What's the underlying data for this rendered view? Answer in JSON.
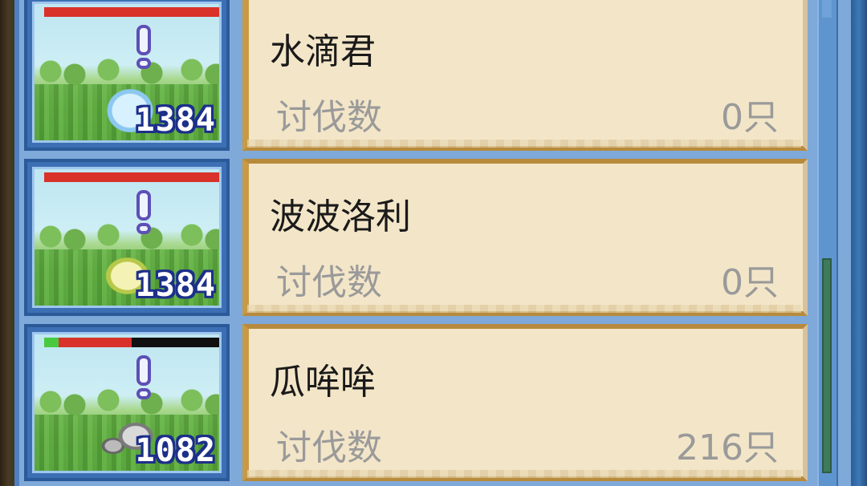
{
  "monsters": [
    {
      "name": "水滴君",
      "kill_label": "讨伐数",
      "kill_count": "0只",
      "power": "1384",
      "sprite": "water-drop-monster",
      "hp_fraction": 1.0
    },
    {
      "name": "波波洛利",
      "kill_label": "讨伐数",
      "kill_count": "0只",
      "power": "1384",
      "sprite": "lemon-monster",
      "hp_fraction": 1.0
    },
    {
      "name": "瓜哞哞",
      "kill_label": "讨伐数",
      "kill_count": "216只",
      "power": "1082",
      "sprite": "robot-monster",
      "hp_fraction": 0.5
    }
  ],
  "colors": {
    "panel_blue": "#7fa9d9",
    "card_bg": "#f3e6c8",
    "hp_red": "#d8322a",
    "hp_green": "#49c940",
    "power_outline": "#1c2f8a"
  },
  "icons": {
    "alert": "exclamation-icon"
  }
}
